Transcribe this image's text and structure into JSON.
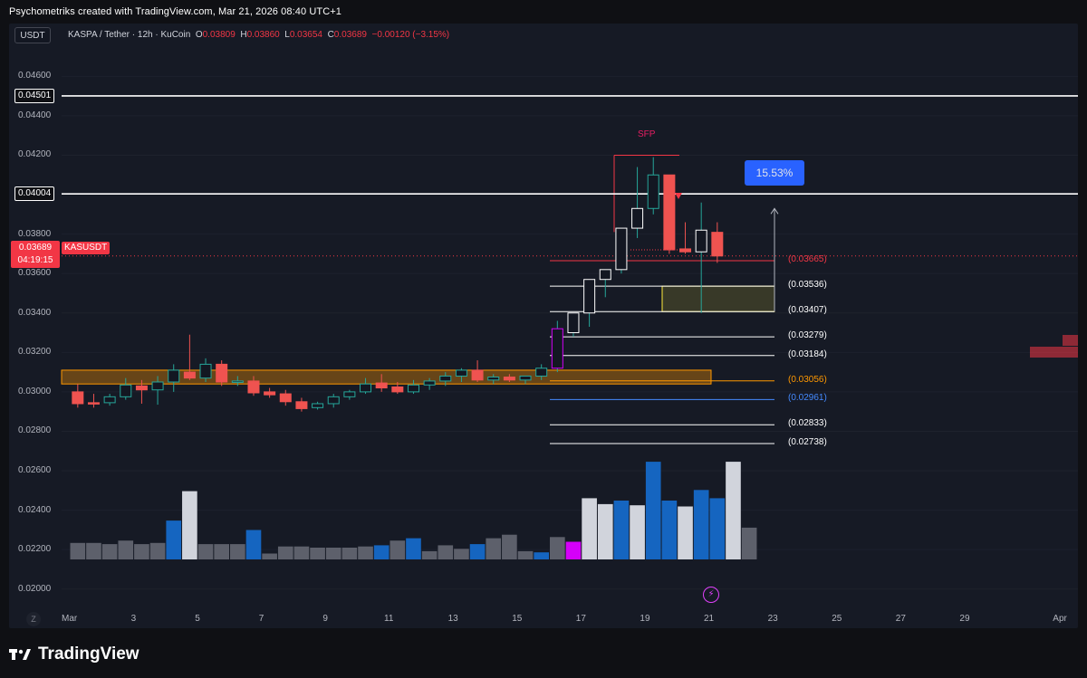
{
  "attribution": "Psychometriks created with TradingView.com, Mar 21, 2026 08:40 UTC+1",
  "toolbar": {
    "currency": "USDT"
  },
  "legend": {
    "symbol": "KASPA / Tether · 12h · KuCoin",
    "open_label": "O",
    "open": "0.03809",
    "high_label": "H",
    "high": "0.03860",
    "low_label": "L",
    "low": "0.03654",
    "close_label": "C",
    "close": "0.03689",
    "change": "−0.00120 (−3.15%)"
  },
  "annotations": {
    "sfp": "SFP",
    "target_pct": "15.53%",
    "price_box": {
      "price": "0.03689",
      "countdown": "04:19:15"
    },
    "symbol_tag": "KASUSDT"
  },
  "footer": {
    "brand": "TradingView"
  },
  "zoom_button": "Z",
  "chart_data": {
    "type": "candlestick",
    "symbol": "KASUSDT",
    "interval": "12h",
    "exchange": "KuCoin",
    "colors": {
      "up": "#26a69a",
      "down": "#ef5350",
      "up_body": "#131722",
      "down_body": "#ef5350",
      "accent": "#2962ff"
    },
    "y_axis": {
      "ticks": [
        "0.04600",
        "0.04400",
        "0.04200",
        "0.03800",
        "0.03600",
        "0.03400",
        "0.03200",
        "0.03000",
        "0.02800",
        "0.02600",
        "0.02400",
        "0.02200",
        "0.02000"
      ],
      "ylim": [
        0.0193,
        0.0473
      ]
    },
    "x_axis": {
      "ticks": [
        {
          "label": "Mar",
          "day": 1
        },
        {
          "label": "3",
          "day": 3
        },
        {
          "label": "5",
          "day": 5
        },
        {
          "label": "7",
          "day": 7
        },
        {
          "label": "9",
          "day": 9
        },
        {
          "label": "11",
          "day": 11
        },
        {
          "label": "13",
          "day": 13
        },
        {
          "label": "15",
          "day": 15
        },
        {
          "label": "17",
          "day": 17
        },
        {
          "label": "19",
          "day": 19
        },
        {
          "label": "21",
          "day": 21
        },
        {
          "label": "23",
          "day": 23
        },
        {
          "label": "25",
          "day": 25
        },
        {
          "label": "27",
          "day": 27
        },
        {
          "label": "29",
          "day": 29
        },
        {
          "label": "Apr",
          "day": 32
        }
      ]
    },
    "candles": [
      {
        "o": 0.03,
        "h": 0.0304,
        "l": 0.0292,
        "c": 0.0294
      },
      {
        "o": 0.02945,
        "h": 0.0299,
        "l": 0.0292,
        "c": 0.0294
      },
      {
        "o": 0.02945,
        "h": 0.0299,
        "l": 0.0293,
        "c": 0.02975
      },
      {
        "o": 0.02975,
        "h": 0.0307,
        "l": 0.0296,
        "c": 0.03035
      },
      {
        "o": 0.0303,
        "h": 0.0306,
        "l": 0.0294,
        "c": 0.0301
      },
      {
        "o": 0.0301,
        "h": 0.0308,
        "l": 0.02935,
        "c": 0.0305
      },
      {
        "o": 0.0305,
        "h": 0.0314,
        "l": 0.03,
        "c": 0.0311
      },
      {
        "o": 0.031,
        "h": 0.0329,
        "l": 0.0306,
        "c": 0.0307
      },
      {
        "o": 0.0307,
        "h": 0.0317,
        "l": 0.0305,
        "c": 0.0314
      },
      {
        "o": 0.0314,
        "h": 0.0316,
        "l": 0.0303,
        "c": 0.0305
      },
      {
        "o": 0.0305,
        "h": 0.0308,
        "l": 0.0303,
        "c": 0.03055
      },
      {
        "o": 0.03055,
        "h": 0.0308,
        "l": 0.0298,
        "c": 0.02995
      },
      {
        "o": 0.03,
        "h": 0.0302,
        "l": 0.0297,
        "c": 0.02985
      },
      {
        "o": 0.0299,
        "h": 0.0301,
        "l": 0.0293,
        "c": 0.0295
      },
      {
        "o": 0.0295,
        "h": 0.0297,
        "l": 0.029,
        "c": 0.02915
      },
      {
        "o": 0.0292,
        "h": 0.0295,
        "l": 0.0291,
        "c": 0.0294
      },
      {
        "o": 0.0294,
        "h": 0.0299,
        "l": 0.0292,
        "c": 0.02975
      },
      {
        "o": 0.02975,
        "h": 0.0301,
        "l": 0.0296,
        "c": 0.03
      },
      {
        "o": 0.03,
        "h": 0.0307,
        "l": 0.0299,
        "c": 0.0304
      },
      {
        "o": 0.03045,
        "h": 0.0309,
        "l": 0.03,
        "c": 0.0302
      },
      {
        "o": 0.03025,
        "h": 0.0305,
        "l": 0.0299,
        "c": 0.03
      },
      {
        "o": 0.03,
        "h": 0.0306,
        "l": 0.0299,
        "c": 0.03035
      },
      {
        "o": 0.03035,
        "h": 0.0307,
        "l": 0.0301,
        "c": 0.03055
      },
      {
        "o": 0.03055,
        "h": 0.031,
        "l": 0.0303,
        "c": 0.0308
      },
      {
        "o": 0.0308,
        "h": 0.0312,
        "l": 0.0305,
        "c": 0.0311
      },
      {
        "o": 0.0311,
        "h": 0.0316,
        "l": 0.0305,
        "c": 0.0306
      },
      {
        "o": 0.0306,
        "h": 0.0309,
        "l": 0.0304,
        "c": 0.03075
      },
      {
        "o": 0.03075,
        "h": 0.0309,
        "l": 0.0305,
        "c": 0.0306
      },
      {
        "o": 0.0306,
        "h": 0.0308,
        "l": 0.0304,
        "c": 0.0308
      },
      {
        "o": 0.0308,
        "h": 0.0314,
        "l": 0.0306,
        "c": 0.0312
      },
      {
        "o": 0.0312,
        "h": 0.0336,
        "l": 0.031,
        "c": 0.0332
      },
      {
        "o": 0.033,
        "h": 0.0338,
        "l": 0.0328,
        "c": 0.034
      },
      {
        "o": 0.034,
        "h": 0.0345,
        "l": 0.0333,
        "c": 0.0357
      },
      {
        "o": 0.0357,
        "h": 0.0362,
        "l": 0.0348,
        "c": 0.0362
      },
      {
        "o": 0.0362,
        "h": 0.038,
        "l": 0.036,
        "c": 0.0383
      },
      {
        "o": 0.0383,
        "h": 0.0414,
        "l": 0.0378,
        "c": 0.0393
      },
      {
        "o": 0.0393,
        "h": 0.0419,
        "l": 0.039,
        "c": 0.041
      },
      {
        "o": 0.041,
        "h": 0.041,
        "l": 0.037,
        "c": 0.0372
      },
      {
        "o": 0.03725,
        "h": 0.0386,
        "l": 0.037,
        "c": 0.0371
      },
      {
        "o": 0.0371,
        "h": 0.0396,
        "l": 0.034,
        "c": 0.0382
      },
      {
        "o": 0.03809,
        "h": 0.0386,
        "l": 0.03654,
        "c": 0.03689
      }
    ],
    "volume": {
      "colors": {
        "neutral": "#5d606b",
        "high": "#d1d4dc",
        "blue": "#1565c0",
        "magenta": "#d500f9"
      },
      "values": [
        14,
        14,
        13,
        16,
        13,
        14,
        33,
        58,
        13,
        13,
        13,
        25,
        5,
        11,
        11,
        10,
        10,
        10,
        11,
        12,
        16,
        18,
        7,
        12,
        9,
        13,
        18,
        21,
        7,
        6,
        19,
        15,
        52,
        47,
        50,
        46,
        83,
        50,
        45,
        59,
        52,
        83,
        27
      ],
      "color_keys": [
        "neutral",
        "neutral",
        "neutral",
        "neutral",
        "neutral",
        "neutral",
        "blue",
        "high",
        "neutral",
        "neutral",
        "neutral",
        "blue",
        "neutral",
        "neutral",
        "neutral",
        "neutral",
        "neutral",
        "neutral",
        "neutral",
        "blue",
        "neutral",
        "blue",
        "neutral",
        "neutral",
        "neutral",
        "blue",
        "neutral",
        "neutral",
        "neutral",
        "blue",
        "neutral",
        "magenta",
        "high",
        "high",
        "blue",
        "high",
        "blue",
        "blue",
        "high",
        "blue",
        "blue",
        "high",
        "neutral"
      ]
    },
    "horizontal_levels": [
      {
        "price": 0.04501,
        "label": "0.04501",
        "color": "#ffffff"
      },
      {
        "price": 0.04004,
        "label": "0.04004",
        "color": "#ffffff"
      }
    ],
    "fib_levels": [
      {
        "price": 0.03665,
        "label": "(0.03665)",
        "color": "#f23645"
      },
      {
        "price": 0.03536,
        "label": "(0.03536)",
        "color": "#ffffff"
      },
      {
        "price": 0.03407,
        "label": "(0.03407)",
        "color": "#ffffff"
      },
      {
        "price": 0.03279,
        "label": "(0.03279)",
        "color": "#ffffff"
      },
      {
        "price": 0.03184,
        "label": "(0.03184)",
        "color": "#ffffff"
      },
      {
        "price": 0.03056,
        "label": "(0.03056)",
        "color": "#ff9800"
      },
      {
        "price": 0.02961,
        "label": "(0.02961)",
        "color": "#448aff"
      },
      {
        "price": 0.02833,
        "label": "(0.02833)",
        "color": "#ffffff"
      },
      {
        "price": 0.02738,
        "label": "(0.02738)",
        "color": "#ffffff"
      }
    ],
    "zones": [
      {
        "name": "range-zone",
        "from": 0.0304,
        "to": 0.0311,
        "color": "#ff9800"
      },
      {
        "name": "demand-zone",
        "from": 0.03407,
        "to": 0.03536,
        "color": "#ffeb3b"
      },
      {
        "name": "sfp-high-zone",
        "from": 0.0414,
        "to": 0.042,
        "color": "#f23645"
      }
    ],
    "current_price": 0.03689
  }
}
